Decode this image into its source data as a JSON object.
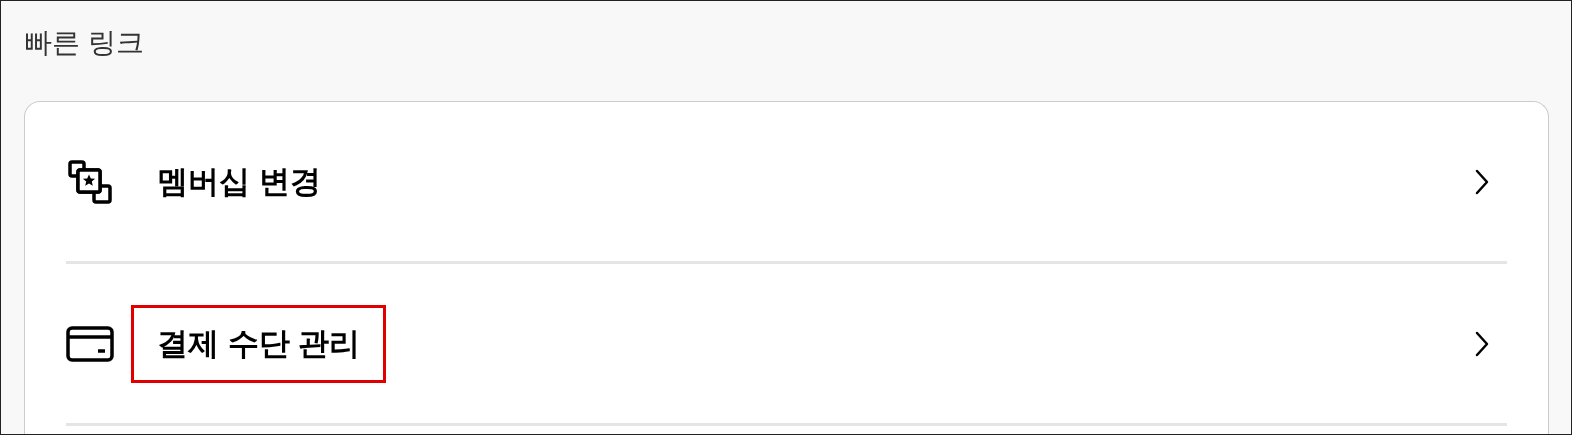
{
  "section_title": "빠른 링크",
  "links": [
    {
      "kind": "membership",
      "label": "멤버십 변경",
      "highlighted": false
    },
    {
      "kind": "payment",
      "label": "결제 수단 관리",
      "highlighted": true
    }
  ]
}
